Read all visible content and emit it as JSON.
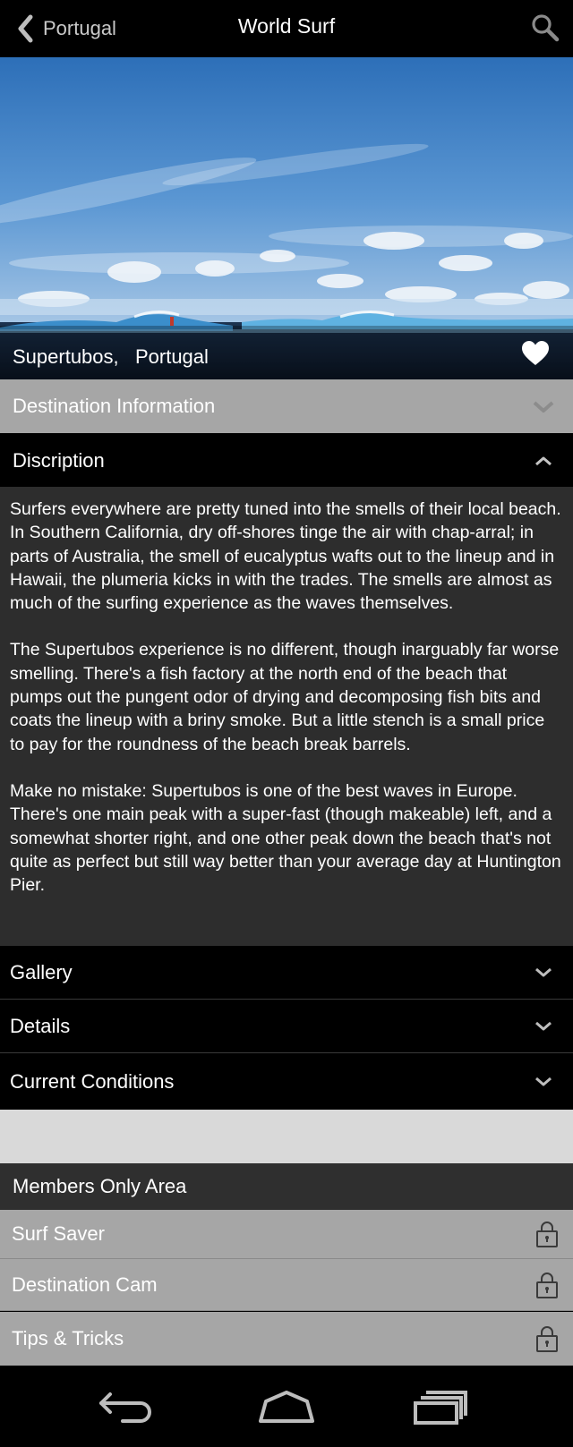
{
  "app_bar": {
    "back_label": "Portugal",
    "title": "World Surf",
    "icons": {
      "back": "chevron-left-icon",
      "search": "search-icon"
    }
  },
  "hero": {
    "caption": "Supertubos,   Portugal",
    "favorite_icon": "heart-icon"
  },
  "sections": {
    "destination_information": "Destination Information",
    "description": "Discription",
    "gallery": "Gallery",
    "details": "Details",
    "current_conditions": "Current Conditions"
  },
  "description": {
    "paragraphs": [
      "Surfers everywhere are pretty tuned into the smells of their local beach. In Southern California, dry off-shores tinge the air with chap-arral; in parts of Australia, the smell of eucalyptus wafts out to the lineup and in Hawaii, the plumeria kicks in with the trades. The smells are almost as much of the surfing experience as the waves themselves.",
      "The Supertubos experience is no different, though inarguably far worse smelling. There's a fish factory at the north end of the beach that pumps out the pungent odor of drying and decomposing fish bits and coats the lineup with a briny smoke. But a little stench is a small price to pay for the roundness of the beach break barrels.",
      "Make no mistake: Supertubos is one of the best waves in Europe. There's one main peak with a super-fast (though makeable) left, and a somewhat shorter right, and one other peak down the beach that's not quite as perfect but still way better than your average day at Huntington Pier."
    ]
  },
  "members": {
    "header": "Members Only Area",
    "items": [
      {
        "label": "Surf Saver",
        "icon": "lock-icon"
      },
      {
        "label": "Destination Cam",
        "icon": "lock-icon"
      },
      {
        "label": "Tips & Tricks",
        "icon": "lock-icon"
      }
    ]
  },
  "colors": {
    "app_bar": "#000000",
    "collapsed_header_gray": "#a6a6a6",
    "description_background": "#2d2d2d",
    "members_header": "#2f2f2f",
    "spacer": "#d9d9d9"
  },
  "system_nav": {
    "icons": [
      "back-icon",
      "home-icon",
      "recents-icon"
    ]
  }
}
